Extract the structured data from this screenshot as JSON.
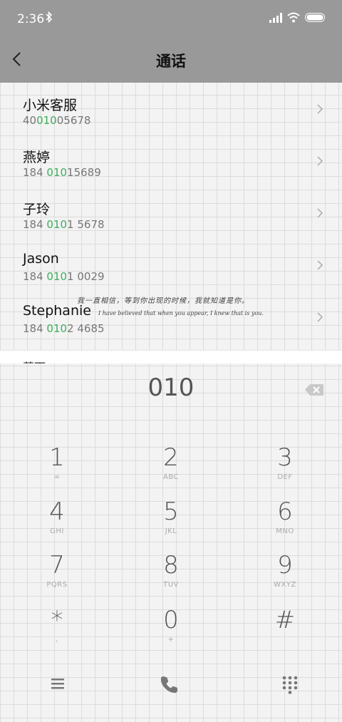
{
  "status_bar": {
    "time": "2:36"
  },
  "header": {
    "title": "通话"
  },
  "results": [
    {
      "name": "小米客服",
      "number_pre": "40",
      "number_hl": "010",
      "number_post": "05678"
    },
    {
      "name": "燕婷",
      "number_pre": "184 ",
      "number_hl": "010",
      "number_post": "15689"
    },
    {
      "name": "子玲",
      "number_pre": "184 ",
      "number_hl": "010",
      "number_post": "1 5678"
    },
    {
      "name": "Jason",
      "number_pre": "184 ",
      "number_hl": "010",
      "number_post": "1 0029"
    },
    {
      "name": "Stephanie",
      "number_pre": "184 ",
      "number_hl": "010",
      "number_post": "2 4685"
    }
  ],
  "partial_item": {
    "name": "萧雨"
  },
  "watermark": {
    "line_cn": "我一直相信，等到你出现的时候，我就知道是你。",
    "line_en": "I have believed that when you appear, I knew that is you."
  },
  "dialpad": {
    "input": "010",
    "keys": [
      {
        "digit": "1",
        "letters": "∞"
      },
      {
        "digit": "2",
        "letters": "ABC"
      },
      {
        "digit": "3",
        "letters": "DEF"
      },
      {
        "digit": "4",
        "letters": "GHI"
      },
      {
        "digit": "5",
        "letters": "JKL"
      },
      {
        "digit": "6",
        "letters": "MNO"
      },
      {
        "digit": "7",
        "letters": "PQRS"
      },
      {
        "digit": "8",
        "letters": "TUV"
      },
      {
        "digit": "9",
        "letters": "WXYZ"
      },
      {
        "digit": "*",
        "letters": ","
      },
      {
        "digit": "0",
        "letters": "+"
      },
      {
        "digit": "#",
        "letters": ""
      }
    ]
  },
  "colors": {
    "accent": "#3cae5a",
    "header_bg": "#999999"
  },
  "icons": {
    "back": "chevron-left-icon",
    "row": "chevron-right-icon",
    "backspace": "backspace-icon",
    "menu": "menu-icon",
    "call": "phone-icon",
    "keypad": "dialpad-icon"
  }
}
